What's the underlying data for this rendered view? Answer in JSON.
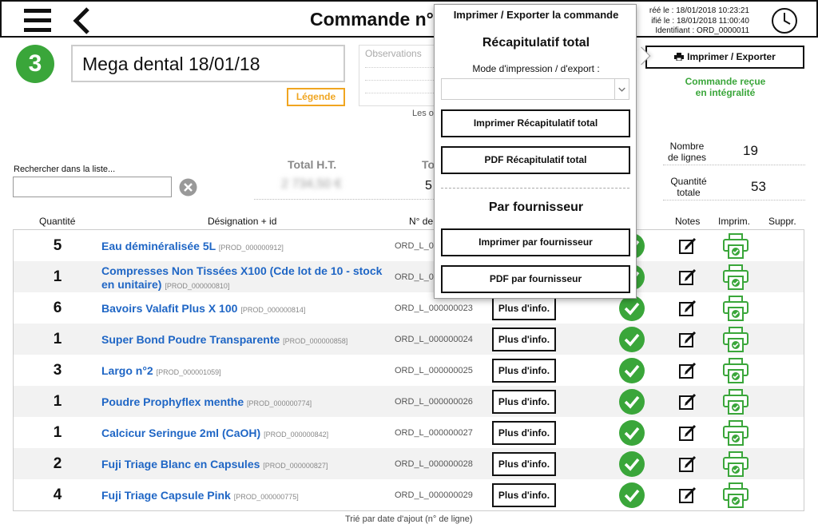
{
  "header": {
    "title": "Commande n°",
    "meta": {
      "created": "réé le : 18/01/2018 10:23:21",
      "modified": "ifié le : 18/01/2018 11:00:40",
      "identifier": "Identifiant : ORD_0000011"
    }
  },
  "order": {
    "step": "3",
    "name": "Mega dental 18/01/18",
    "legend_label": "Légende",
    "observations_placeholder": "Observations",
    "observations_note": "Les o"
  },
  "search": {
    "label": "Rechercher dans la liste...",
    "value": ""
  },
  "totals": {
    "ht_label": "Total H.T.",
    "ht_value": "2 734,50 €",
    "ttc_label": "To",
    "ttc_value": "5"
  },
  "stats": {
    "lines_label_1": "Nombre",
    "lines_label_2": "de lignes",
    "lines_value": "19",
    "qty_label_1": "Quantité",
    "qty_label_2": "totale",
    "qty_value": "53"
  },
  "actions": {
    "print_export_label": "Imprimer / Exporter",
    "status_1": "Commande reçue",
    "status_2": "en intégralité"
  },
  "table": {
    "headers": {
      "quantity": "Quantité",
      "designation": "Désignation + id",
      "order_no": "N° de",
      "notes": "Notes",
      "print": "Imprim.",
      "delete": "Suppr."
    },
    "more_label": "Plus d'info.",
    "rows": [
      {
        "qty": "5",
        "name": "Eau déminéralisée 5L",
        "pid": "[PROD_000000912]",
        "ord": "ORD_L_0"
      },
      {
        "qty": "1",
        "name": "Compresses Non Tissées X100 (Cde lot de 10 - stock en unitaire)",
        "pid": "[PROD_000000810]",
        "ord": "ORD_L_0"
      },
      {
        "qty": "6",
        "name": "Bavoirs Valafit Plus X 100",
        "pid": "[PROD_000000814]",
        "ord": "ORD_L_000000023"
      },
      {
        "qty": "1",
        "name": "Super Bond Poudre Transparente",
        "pid": "[PROD_000000858]",
        "ord": "ORD_L_000000024"
      },
      {
        "qty": "3",
        "name": "Largo n°2",
        "pid": "[PROD_000001059]",
        "ord": "ORD_L_000000025"
      },
      {
        "qty": "1",
        "name": "Poudre Prophyflex menthe",
        "pid": "[PROD_000000774]",
        "ord": "ORD_L_000000026"
      },
      {
        "qty": "1",
        "name": "Calcicur Seringue 2ml (CaOH)",
        "pid": "[PROD_000000842]",
        "ord": "ORD_L_000000027"
      },
      {
        "qty": "2",
        "name": "Fuji Triage Blanc en Capsules",
        "pid": "[PROD_000000827]",
        "ord": "ORD_L_000000028"
      },
      {
        "qty": "4",
        "name": "Fuji Triage Capsule Pink",
        "pid": "[PROD_000000775]",
        "ord": "ORD_L_000000029"
      }
    ],
    "sort_note": "Trié par date d'ajout (n° de ligne)"
  },
  "popup": {
    "title": "Imprimer / Exporter la commande",
    "recap_title": "Récapitulatif total",
    "mode_label": "Mode d'impression / d'export :",
    "mode_value": "",
    "print_recap": "Imprimer Récapitulatif total",
    "pdf_recap": "PDF Récapitulatif total",
    "supplier_title": "Par fournisseur",
    "print_supplier": "Imprimer par fournisseur",
    "pdf_supplier": "PDF par fournisseur"
  },
  "colors": {
    "accent_green": "#3aa63a",
    "link_blue": "#1f66c5",
    "legend_orange": "#f0a520"
  }
}
